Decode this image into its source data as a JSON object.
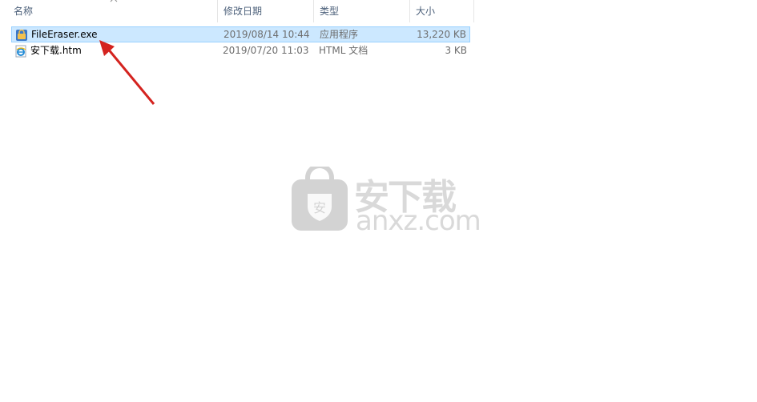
{
  "columns": {
    "name": "名称",
    "date": "修改日期",
    "type": "类型",
    "size": "大小"
  },
  "files": [
    {
      "name": "FileEraser.exe",
      "date": "2019/08/14 10:44",
      "type": "应用程序",
      "size": "13,220 KB",
      "icon": "exe-app-icon",
      "selected": true
    },
    {
      "name": "安下载.htm",
      "date": "2019/07/20 11:03",
      "type": "HTML 文档",
      "size": "3 KB",
      "icon": "ie-html-icon",
      "selected": false
    }
  ],
  "watermark": {
    "title": "安下载",
    "domain": "anxz.com",
    "badge": "安"
  },
  "colors": {
    "selection_bg": "#cce8ff",
    "selection_border": "#99d1ff",
    "header_text": "#4c607a",
    "arrow": "#d4231f"
  }
}
